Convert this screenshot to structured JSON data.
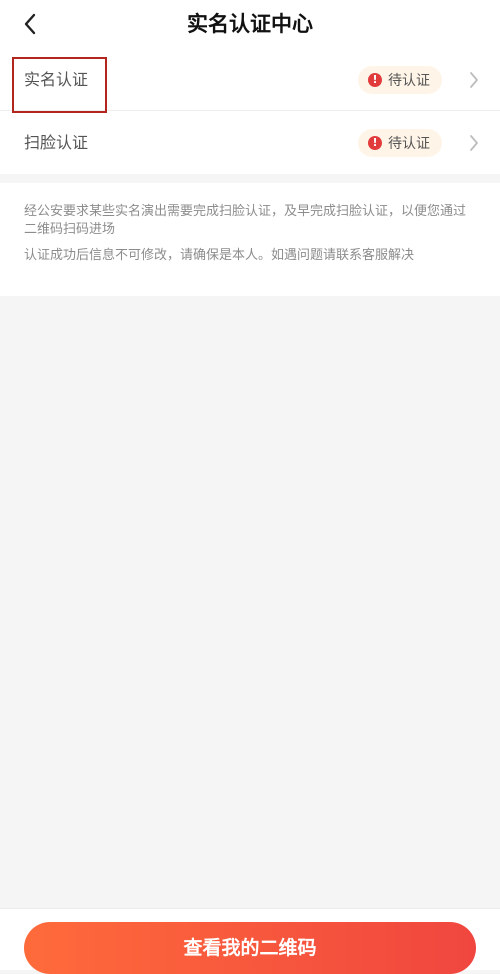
{
  "header": {
    "title": "实名认证中心"
  },
  "verification": {
    "items": [
      {
        "label": "实名认证",
        "status": "待认证"
      },
      {
        "label": "扫脸认证",
        "status": "待认证"
      }
    ]
  },
  "notice": {
    "line1": "经公安要求某些实名演出需要完成扫脸认证，及早完成扫脸认证，以便您通过二维码扫码进场",
    "line2": "认证成功后信息不可修改，请确保是本人。如遇问题请联系客服解决"
  },
  "footer": {
    "button_label": "查看我的二维码"
  },
  "colors": {
    "accent_start": "#ff6b3b",
    "accent_end": "#f0463f",
    "warning": "#e23b3b",
    "highlight": "#b3261e"
  }
}
